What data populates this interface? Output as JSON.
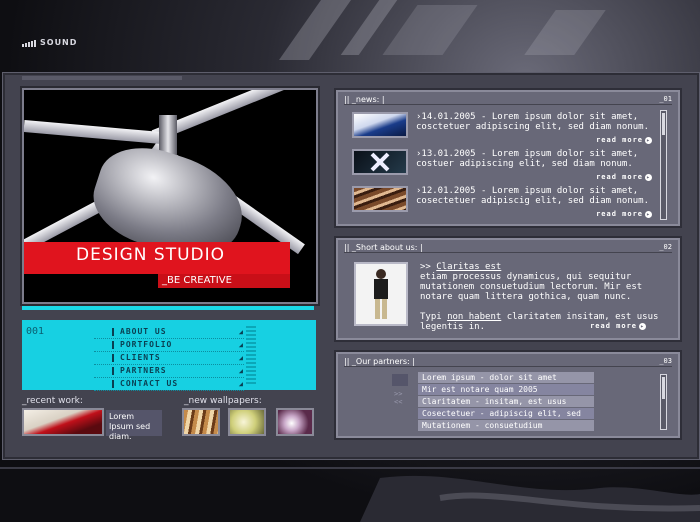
{
  "topbar": {
    "sound_label": "SOUND"
  },
  "hero": {
    "title": "DESIGN STUDIO",
    "tagline": "_BE CREATIVE"
  },
  "menu": {
    "number": "001",
    "items": [
      {
        "label": "ABOUT US"
      },
      {
        "label": "PORTFOLIO"
      },
      {
        "label": "CLIENTS"
      },
      {
        "label": "PARTNERS"
      },
      {
        "label": "CONTACT US"
      }
    ]
  },
  "recent_work": {
    "label": "_recent work:",
    "text": "Lorem Ipsum sed diam."
  },
  "new_wallpapers": {
    "label": "_new wallpapers:"
  },
  "news": {
    "header": "|| _news: |",
    "number": "_01",
    "read_more": "read more",
    "items": [
      {
        "text": "›14.01.2005 - Lorem ipsum dolor sit amet, cosctetuer adipiscing elit, sed diam nonum."
      },
      {
        "text": "›13.01.2005 - Lorem ipsum dolor sit amet, costuer adipiscing elit, sed diam nonum."
      },
      {
        "text": "›12.01.2005 - Lorem ipsum dolor sit amet, cosectetuer adipiscig elit, sed diam nonum."
      }
    ]
  },
  "about": {
    "header": "|| _Short about us: |",
    "number": "_02",
    "prefix": ">> ",
    "link": "Claritas est",
    "paragraph1": "etiam processus dynamicus, qui sequitur mutationem consuetudium lectorum. Mir est notare quam littera gothica, quam nunc.",
    "p2_before": "Typi ",
    "p2_link": "non habent",
    "p2_after": " claritatem insitam, est usus legentis in.",
    "read_more": "read more"
  },
  "partners": {
    "header": "|| _Our partners: |",
    "number": "_03",
    "items": [
      {
        "label": "Lorem ipsum - dolor sit amet"
      },
      {
        "label": "Mir est notare quam 2005"
      },
      {
        "label": "Claritatem - insitam, est usus"
      },
      {
        "label": "Cosectetuer - adipiscig elit, sed"
      },
      {
        "label": "Mutationem - consuetudium"
      }
    ]
  },
  "colors": {
    "accent": "#17d0e2",
    "brand_red": "#e0141e",
    "panel": "#686878"
  }
}
